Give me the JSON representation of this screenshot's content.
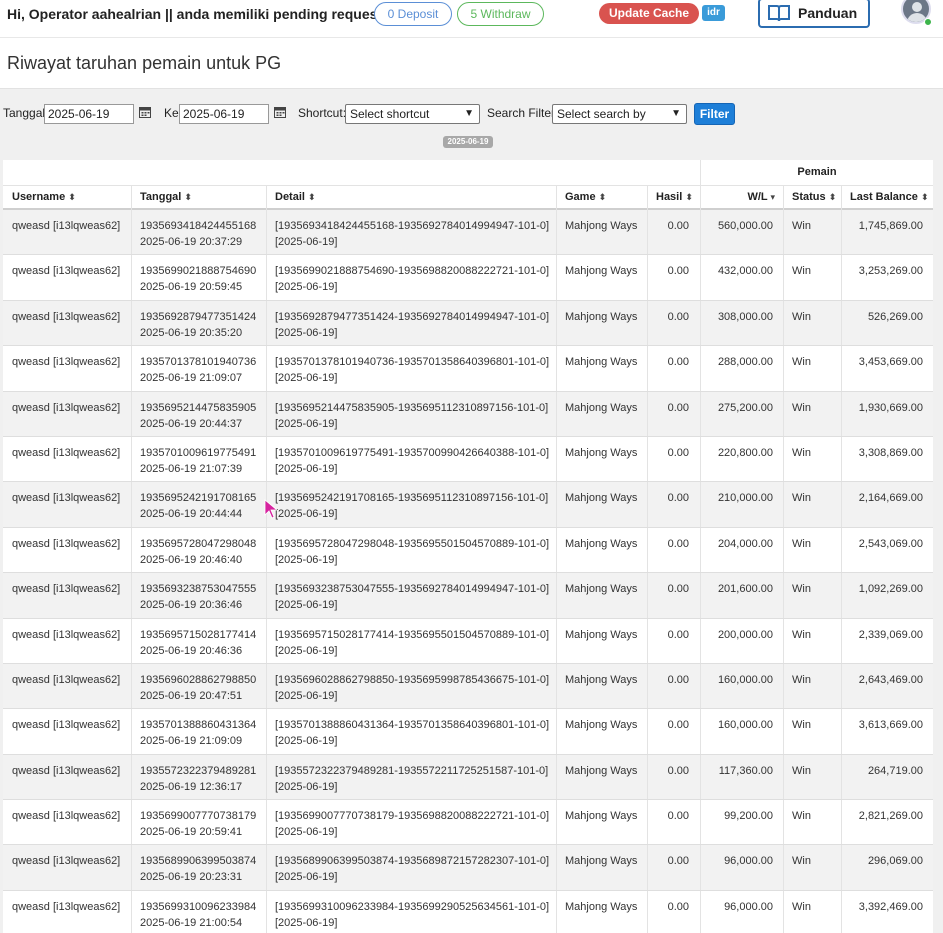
{
  "header": {
    "greeting": "Hi, Operator aahealrian || anda memiliki pending request:",
    "deposit_pill": "0 Deposit",
    "withdraw_pill": "5 Withdraw",
    "update_cache": "Update Cache",
    "currency_badge": "idr",
    "guide_button": "Panduan"
  },
  "page": {
    "title": "Riwayat taruhan pemain untuk PG"
  },
  "filters": {
    "date_from_label": "Tanggal",
    "date_from": "2025-06-19",
    "date_to_label": "Ke",
    "date_to": "2025-06-19",
    "shortcut_label": "Shortcut:",
    "shortcut_value": "Select shortcut",
    "search_label": "Search Filter:",
    "search_value": "Select search by",
    "filter_button": "Filter",
    "date_chip": "2025-06-19"
  },
  "table": {
    "group_label": "Pemain",
    "columns": [
      "Username",
      "Tanggal",
      "Detail",
      "Game",
      "Hasil",
      "W/L",
      "Status",
      "Last Balance"
    ],
    "rows": [
      {
        "username": "qweasd [i13lqweas62]",
        "id": "1935693418424455168",
        "time": "2025-06-19 20:37:29",
        "detail": "[1935693418424455168-1935692784014994947-101-0]",
        "detail_date": "[2025-06-19]",
        "game": "Mahjong Ways",
        "hasil": "0.00",
        "wl": "560,000.00",
        "status": "Win",
        "balance": "1,745,869.00"
      },
      {
        "username": "qweasd [i13lqweas62]",
        "id": "1935699021888754690",
        "time": "2025-06-19 20:59:45",
        "detail": "[1935699021888754690-1935698820088222721-101-0]",
        "detail_date": "[2025-06-19]",
        "game": "Mahjong Ways",
        "hasil": "0.00",
        "wl": "432,000.00",
        "status": "Win",
        "balance": "3,253,269.00"
      },
      {
        "username": "qweasd [i13lqweas62]",
        "id": "1935692879477351424",
        "time": "2025-06-19 20:35:20",
        "detail": "[1935692879477351424-1935692784014994947-101-0]",
        "detail_date": "[2025-06-19]",
        "game": "Mahjong Ways",
        "hasil": "0.00",
        "wl": "308,000.00",
        "status": "Win",
        "balance": "526,269.00"
      },
      {
        "username": "qweasd [i13lqweas62]",
        "id": "1935701378101940736",
        "time": "2025-06-19 21:09:07",
        "detail": "[1935701378101940736-1935701358640396801-101-0]",
        "detail_date": "[2025-06-19]",
        "game": "Mahjong Ways",
        "hasil": "0.00",
        "wl": "288,000.00",
        "status": "Win",
        "balance": "3,453,669.00"
      },
      {
        "username": "qweasd [i13lqweas62]",
        "id": "1935695214475835905",
        "time": "2025-06-19 20:44:37",
        "detail": "[1935695214475835905-1935695112310897156-101-0]",
        "detail_date": "[2025-06-19]",
        "game": "Mahjong Ways",
        "hasil": "0.00",
        "wl": "275,200.00",
        "status": "Win",
        "balance": "1,930,669.00"
      },
      {
        "username": "qweasd [i13lqweas62]",
        "id": "1935701009619775491",
        "time": "2025-06-19 21:07:39",
        "detail": "[1935701009619775491-1935700990426640388-101-0]",
        "detail_date": "[2025-06-19]",
        "game": "Mahjong Ways",
        "hasil": "0.00",
        "wl": "220,800.00",
        "status": "Win",
        "balance": "3,308,869.00"
      },
      {
        "username": "qweasd [i13lqweas62]",
        "id": "1935695242191708165",
        "time": "2025-06-19 20:44:44",
        "detail": "[1935695242191708165-1935695112310897156-101-0]",
        "detail_date": "[2025-06-19]",
        "game": "Mahjong Ways",
        "hasil": "0.00",
        "wl": "210,000.00",
        "status": "Win",
        "balance": "2,164,669.00"
      },
      {
        "username": "qweasd [i13lqweas62]",
        "id": "1935695728047298048",
        "time": "2025-06-19 20:46:40",
        "detail": "[1935695728047298048-1935695501504570889-101-0]",
        "detail_date": "[2025-06-19]",
        "game": "Mahjong Ways",
        "hasil": "0.00",
        "wl": "204,000.00",
        "status": "Win",
        "balance": "2,543,069.00"
      },
      {
        "username": "qweasd [i13lqweas62]",
        "id": "1935693238753047555",
        "time": "2025-06-19 20:36:46",
        "detail": "[1935693238753047555-1935692784014994947-101-0]",
        "detail_date": "[2025-06-19]",
        "game": "Mahjong Ways",
        "hasil": "0.00",
        "wl": "201,600.00",
        "status": "Win",
        "balance": "1,092,269.00"
      },
      {
        "username": "qweasd [i13lqweas62]",
        "id": "1935695715028177414",
        "time": "2025-06-19 20:46:36",
        "detail": "[1935695715028177414-1935695501504570889-101-0]",
        "detail_date": "[2025-06-19]",
        "game": "Mahjong Ways",
        "hasil": "0.00",
        "wl": "200,000.00",
        "status": "Win",
        "balance": "2,339,069.00"
      },
      {
        "username": "qweasd [i13lqweas62]",
        "id": "1935696028862798850",
        "time": "2025-06-19 20:47:51",
        "detail": "[1935696028862798850-1935695998785436675-101-0]",
        "detail_date": "[2025-06-19]",
        "game": "Mahjong Ways",
        "hasil": "0.00",
        "wl": "160,000.00",
        "status": "Win",
        "balance": "2,643,469.00"
      },
      {
        "username": "qweasd [i13lqweas62]",
        "id": "1935701388860431364",
        "time": "2025-06-19 21:09:09",
        "detail": "[1935701388860431364-1935701358640396801-101-0]",
        "detail_date": "[2025-06-19]",
        "game": "Mahjong Ways",
        "hasil": "0.00",
        "wl": "160,000.00",
        "status": "Win",
        "balance": "3,613,669.00"
      },
      {
        "username": "qweasd [i13lqweas62]",
        "id": "1935572322379489281",
        "time": "2025-06-19 12:36:17",
        "detail": "[1935572322379489281-1935572211725251587-101-0]",
        "detail_date": "[2025-06-19]",
        "game": "Mahjong Ways",
        "hasil": "0.00",
        "wl": "117,360.00",
        "status": "Win",
        "balance": "264,719.00"
      },
      {
        "username": "qweasd [i13lqweas62]",
        "id": "1935699007770738179",
        "time": "2025-06-19 20:59:41",
        "detail": "[1935699007770738179-1935698820088222721-101-0]",
        "detail_date": "[2025-06-19]",
        "game": "Mahjong Ways",
        "hasil": "0.00",
        "wl": "99,200.00",
        "status": "Win",
        "balance": "2,821,269.00"
      },
      {
        "username": "qweasd [i13lqweas62]",
        "id": "1935689906399503874",
        "time": "2025-06-19 20:23:31",
        "detail": "[1935689906399503874-1935689872157282307-101-0]",
        "detail_date": "[2025-06-19]",
        "game": "Mahjong Ways",
        "hasil": "0.00",
        "wl": "96,000.00",
        "status": "Win",
        "balance": "296,069.00"
      },
      {
        "username": "qweasd [i13lqweas62]",
        "id": "1935699310096233984",
        "time": "2025-06-19 21:00:54",
        "detail": "[1935699310096233984-1935699290525634561-101-0]",
        "detail_date": "[2025-06-19]",
        "game": "Mahjong Ways",
        "hasil": "0.00",
        "wl": "96,000.00",
        "status": "Win",
        "balance": "3,392,469.00"
      }
    ]
  }
}
